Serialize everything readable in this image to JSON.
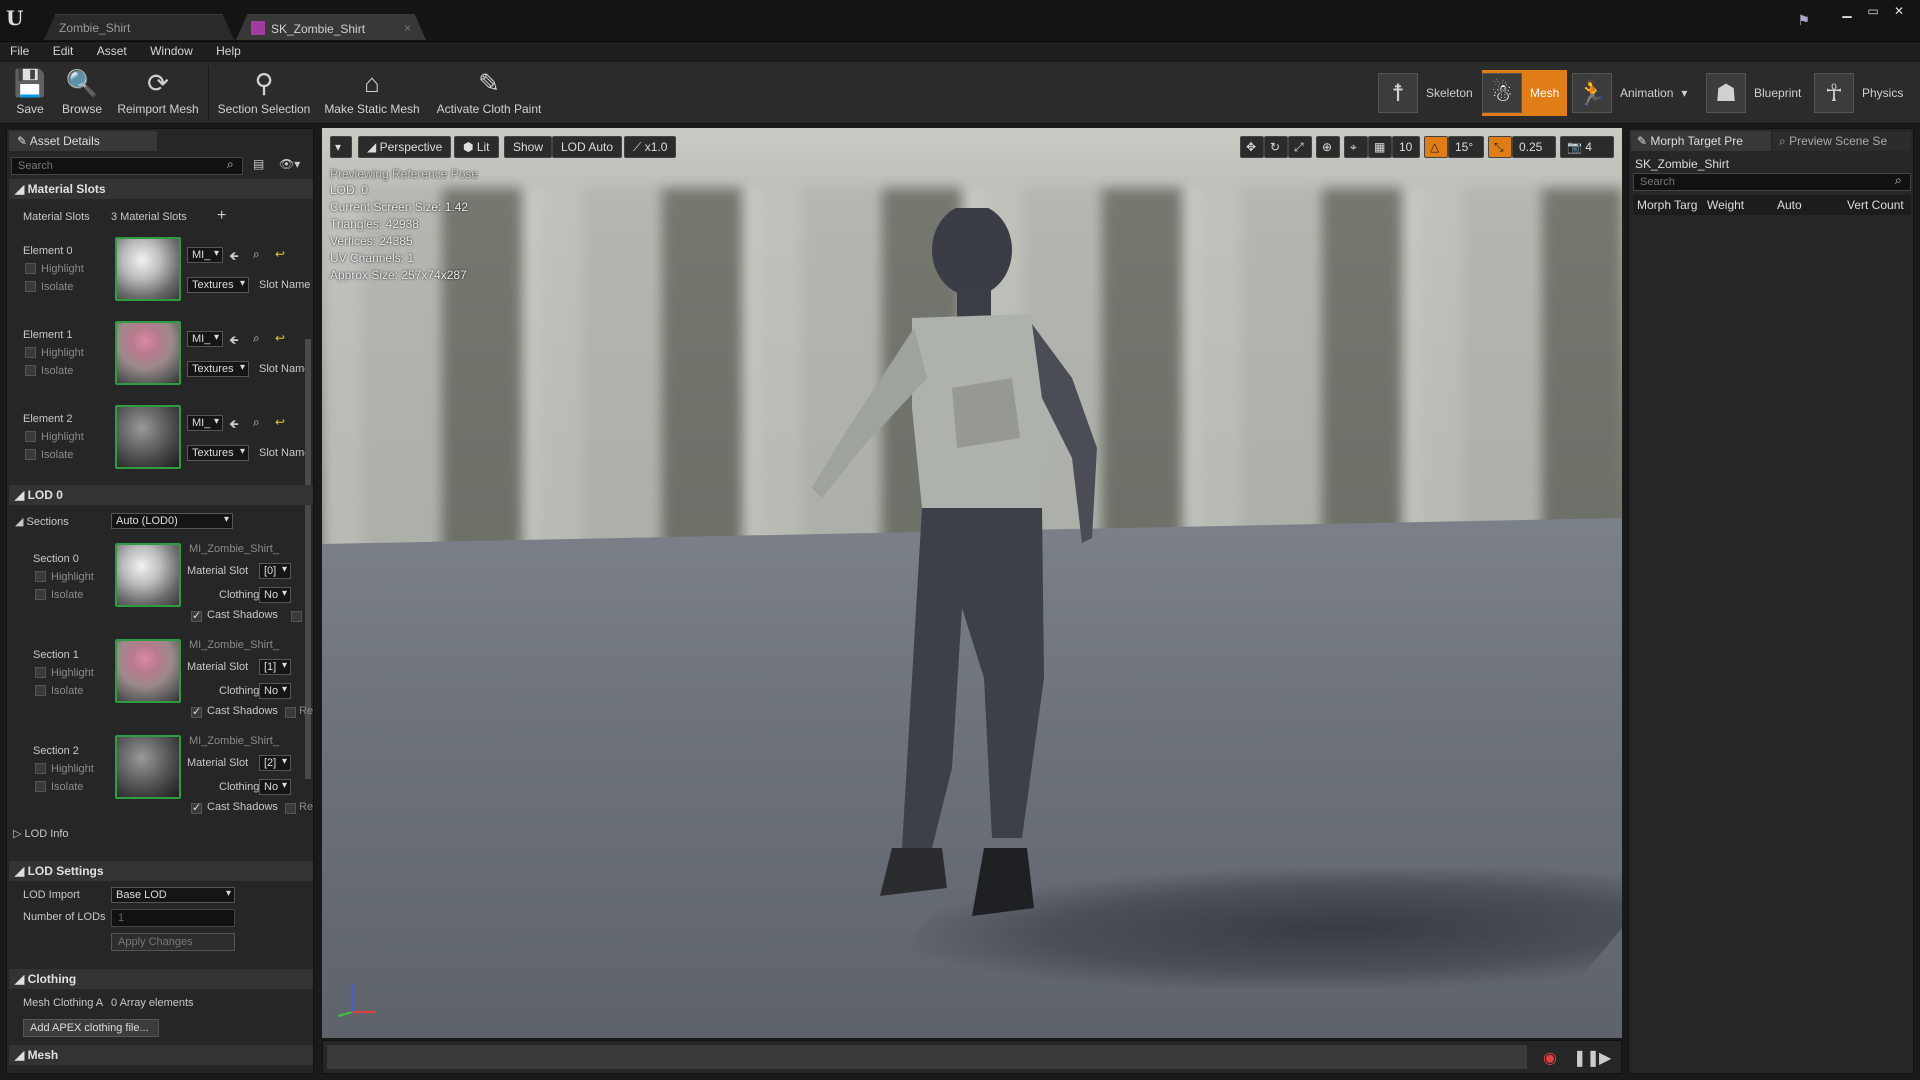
{
  "tabs": [
    {
      "label": "Zombie_Shirt"
    },
    {
      "label": "SK_Zombie_Shirt",
      "close": "×"
    }
  ],
  "window_controls": {
    "minimize": "▁",
    "maximize": "▭",
    "close": "✕"
  },
  "menu": [
    "File",
    "Edit",
    "Asset",
    "Window",
    "Help"
  ],
  "toolbar": {
    "save": "Save",
    "browse": "Browse",
    "reimport": "Reimport Mesh",
    "section_selection": "Section Selection",
    "make_static": "Make Static Mesh",
    "cloth_paint": "Activate Cloth Paint"
  },
  "modes": {
    "skeleton": "Skeleton",
    "mesh": "Mesh",
    "animation": "Animation",
    "blueprint": "Blueprint",
    "physics": "Physics"
  },
  "accent": "#e07d17",
  "asset_details": {
    "tab": "Asset Details",
    "search_placeholder": "Search",
    "material_slots": {
      "header": "Material Slots",
      "label": "Material Slots",
      "count": "3 Material Slots",
      "add": "+",
      "elements": [
        {
          "name": "Element 0",
          "highlight": "Highlight",
          "isolate": "Isolate",
          "mat": "MI_",
          "textures": "Textures",
          "slot_name": "Slot Name"
        },
        {
          "name": "Element 1",
          "highlight": "Highlight",
          "isolate": "Isolate",
          "mat": "MI_",
          "textures": "Textures",
          "slot_name": "Slot Name"
        },
        {
          "name": "Element 2",
          "highlight": "Highlight",
          "isolate": "Isolate",
          "mat": "MI_",
          "textures": "Textures",
          "slot_name": "Slot Name"
        }
      ]
    },
    "lod0": {
      "header": "LOD 0",
      "sections_label": "Sections",
      "sections_value": "Auto (LOD0)",
      "sections": [
        {
          "name": "Section 0",
          "highlight": "Highlight",
          "isolate": "Isolate",
          "mat": "MI_Zombie_Shirt_",
          "slot_label": "Material Slot",
          "slot": "[0]",
          "clothing": "Clothing",
          "clothing_val": "No",
          "cast": "Cast Shadows",
          "extra": ""
        },
        {
          "name": "Section 1",
          "highlight": "Highlight",
          "isolate": "Isolate",
          "mat": "MI_Zombie_Shirt_",
          "slot_label": "Material Slot",
          "slot": "[1]",
          "clothing": "Clothing",
          "clothing_val": "No",
          "cast": "Cast Shadows",
          "extra": "Re"
        },
        {
          "name": "Section 2",
          "highlight": "Highlight",
          "isolate": "Isolate",
          "mat": "MI_Zombie_Shirt_",
          "slot_label": "Material Slot",
          "slot": "[2]",
          "clothing": "Clothing",
          "clothing_val": "No",
          "cast": "Cast Shadows",
          "extra": "Re"
        }
      ],
      "lod_info": "LOD Info"
    },
    "lod_settings": {
      "header": "LOD Settings",
      "import_label": "LOD Import",
      "import_value": "Base LOD",
      "num_label": "Number of LODs",
      "num_value": "1",
      "apply": "Apply Changes"
    },
    "clothing": {
      "header": "Clothing",
      "mesh_label": "Mesh Clothing A",
      "mesh_value": "0 Array elements",
      "add_btn": "Add APEX clothing file..."
    },
    "mesh": {
      "header": "Mesh"
    }
  },
  "viewport": {
    "perspective": "Perspective",
    "lit": "Lit",
    "show": "Show",
    "lod": "LOD Auto",
    "speed": "x1.0",
    "grid": "10",
    "angle": "15°",
    "scale": "0.25",
    "cam": "4",
    "preview": "Previewing Reference Pose",
    "info": [
      "LOD: 0",
      "Current Screen Size: 1.42",
      "Triangles: 42938",
      "Vertices: 24385",
      "UV Channels: 1",
      "Approx Size: 257x74x287"
    ]
  },
  "right_panel": {
    "tab1": "Morph Target Pre",
    "tab2": "Preview Scene Se",
    "asset": "SK_Zombie_Shirt",
    "search_placeholder": "Search",
    "columns": [
      "Morph Targ",
      "Weight",
      "Auto",
      "Vert Count"
    ]
  }
}
